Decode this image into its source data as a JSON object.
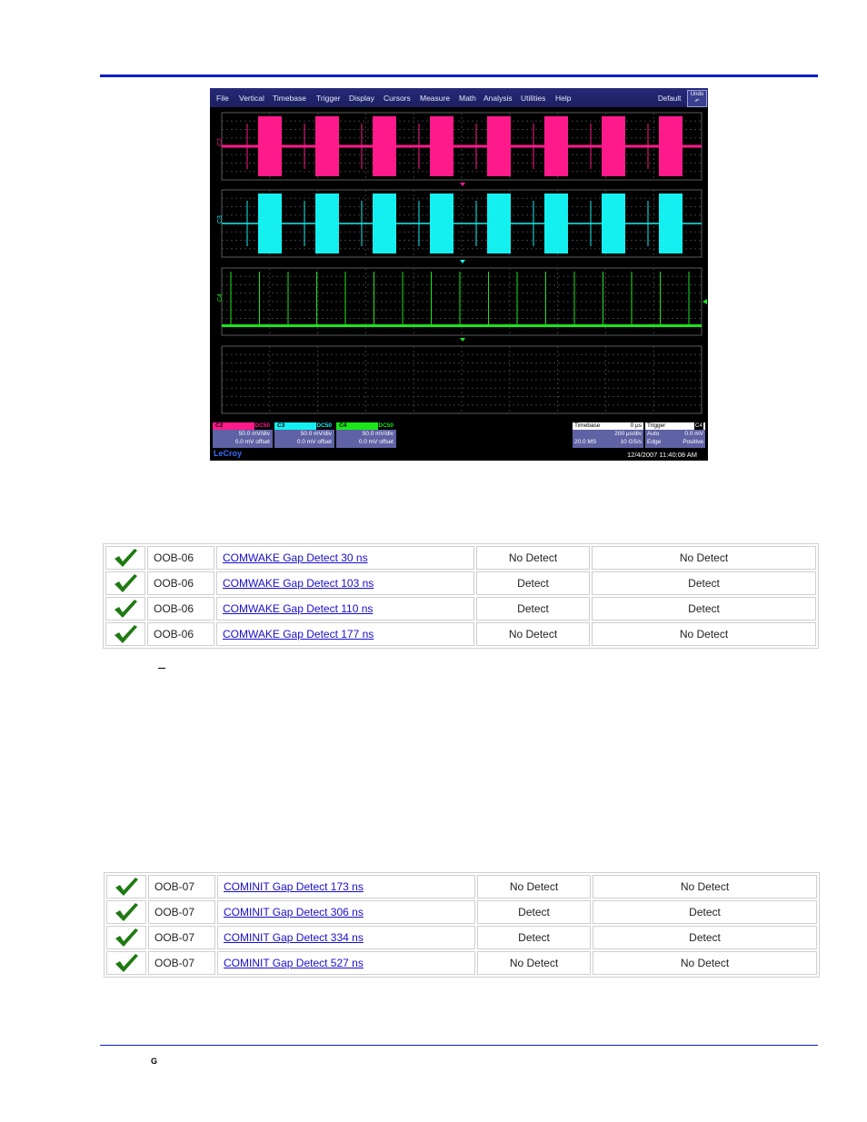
{
  "scope": {
    "menu": [
      "File",
      "Vertical",
      "Timebase",
      "Trigger",
      "Display",
      "Cursors",
      "Measure",
      "Math",
      "Analysis",
      "Utilities",
      "Help"
    ],
    "default_label": "Default",
    "undo_label": "Undo",
    "trace_labels": [
      "C2",
      "C3",
      "C4"
    ],
    "channels": [
      {
        "tag": "C2",
        "badge": "DC50",
        "scale": "50.0 mV/div",
        "offset": "0.0 mV offset",
        "color": "#ff1a8c"
      },
      {
        "tag": "C3",
        "badge": "DC50",
        "scale": "50.0 mV/div",
        "offset": "0.0 mV offset",
        "color": "#14f0f0"
      },
      {
        "tag": "C4",
        "badge": "DC50",
        "scale": "50.0 mV/div",
        "offset": "0.0 mV offset",
        "color": "#1ae61a"
      }
    ],
    "timebase": {
      "title": "Timebase",
      "delay": "0 µs",
      "div": "200 µs/div",
      "samples": "20.0 MS",
      "rate": "10 GS/s"
    },
    "trigger": {
      "title": "Trigger",
      "badge": "C4",
      "mode": "Auto",
      "level": "0.0 mV",
      "type": "Edge",
      "slope": "Positive"
    },
    "brand": "LeCroy",
    "datetime": "12/4/2007 11:40:08 AM"
  },
  "tables": [
    {
      "rows": [
        {
          "id": "OOB-06",
          "name": "COMWAKE Gap Detect 30 ns",
          "expected": "No Detect",
          "result": "No Detect"
        },
        {
          "id": "OOB-06",
          "name": "COMWAKE Gap Detect 103 ns",
          "expected": "Detect",
          "result": "Detect"
        },
        {
          "id": "OOB-06",
          "name": "COMWAKE Gap Detect 110 ns",
          "expected": "Detect",
          "result": "Detect"
        },
        {
          "id": "OOB-06",
          "name": "COMWAKE Gap Detect 177 ns",
          "expected": "No Detect",
          "result": "No Detect"
        }
      ]
    },
    {
      "rows": [
        {
          "id": "OOB-07",
          "name": "COMINIT Gap Detect 173 ns",
          "expected": "No Detect",
          "result": "No Detect"
        },
        {
          "id": "OOB-07",
          "name": "COMINIT Gap Detect 306 ns",
          "expected": "Detect",
          "result": "Detect"
        },
        {
          "id": "OOB-07",
          "name": "COMINIT Gap Detect 334 ns",
          "expected": "Detect",
          "result": "Detect"
        },
        {
          "id": "OOB-07",
          "name": "COMINIT Gap Detect 527 ns",
          "expected": "No Detect",
          "result": "No Detect"
        }
      ]
    }
  ],
  "footer": {
    "mark": "G"
  },
  "colors": {
    "accent": "#0a1ec8",
    "check": "#1f7a12",
    "link": "#1a0dcc"
  }
}
